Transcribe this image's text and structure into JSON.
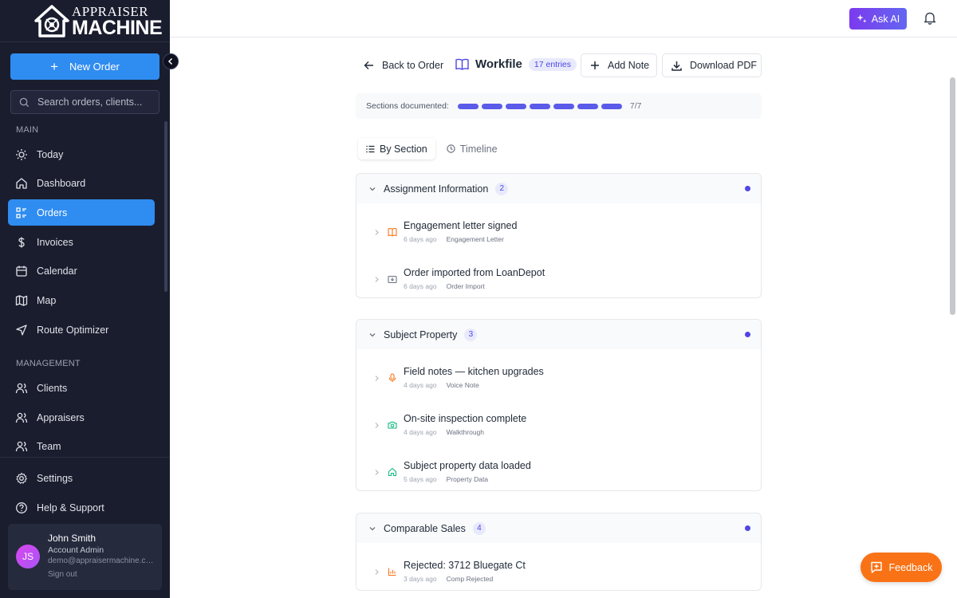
{
  "brand": {
    "line1": "APPRAISER",
    "line2": "MACHINE"
  },
  "sidebar": {
    "new_order": "New Order",
    "search_placeholder": "Search orders, clients...",
    "main_label": "MAIN",
    "main_items": [
      {
        "label": "Today",
        "icon": "sun-icon"
      },
      {
        "label": "Dashboard",
        "icon": "home-icon"
      },
      {
        "label": "Orders",
        "icon": "list-icon",
        "active": true
      },
      {
        "label": "Invoices",
        "icon": "dollar-icon"
      },
      {
        "label": "Calendar",
        "icon": "calendar-icon"
      },
      {
        "label": "Map",
        "icon": "map-icon"
      },
      {
        "label": "Route Optimizer",
        "icon": "navigation-icon"
      }
    ],
    "management_label": "MANAGEMENT",
    "management_items": [
      {
        "label": "Clients",
        "icon": "users-icon"
      },
      {
        "label": "Appraisers",
        "icon": "users-icon"
      },
      {
        "label": "Team",
        "icon": "users-icon"
      }
    ],
    "bottom_items": [
      {
        "label": "Settings",
        "icon": "gear-icon"
      },
      {
        "label": "Help & Support",
        "icon": "help-icon"
      }
    ],
    "user": {
      "initials": "JS",
      "name": "John Smith",
      "role": "Account Admin",
      "email": "demo@appraisermachine.com",
      "sign_out": "Sign out"
    }
  },
  "topbar": {
    "ask_ai": "Ask AI"
  },
  "workfile": {
    "back": "Back to Order",
    "title": "Workfile",
    "entries_badge": "17 entries",
    "add_note": "Add Note",
    "download_pdf": "Download PDF",
    "progress_label": "Sections documented:",
    "progress_value": "7/7",
    "progress_done": 7,
    "progress_total": 7,
    "tabs": [
      "By Section",
      "Timeline"
    ],
    "active_tab": 0
  },
  "sections": [
    {
      "title": "Assignment Information",
      "count": "2",
      "entries": [
        {
          "title": "Engagement letter signed",
          "age": "6 days ago",
          "source": "Engagement Letter",
          "icon": "book-icon",
          "color": "#f97316"
        },
        {
          "title": "Order imported from LoanDepot",
          "age": "6 days ago",
          "source": "Order Import",
          "icon": "download-icon",
          "color": "#6b7280"
        }
      ]
    },
    {
      "title": "Subject Property",
      "count": "3",
      "entries": [
        {
          "title": "Field notes — kitchen upgrades",
          "age": "4 days ago",
          "source": "Voice Note",
          "icon": "microphone-icon",
          "color": "#f97316"
        },
        {
          "title": "On-site inspection complete",
          "age": "4 days ago",
          "source": "Walkthrough",
          "icon": "camera-icon",
          "color": "#10b981"
        },
        {
          "title": "Subject property data loaded",
          "age": "5 days ago",
          "source": "Property Data",
          "icon": "home-icon",
          "color": "#10b981"
        }
      ]
    },
    {
      "title": "Comparable Sales",
      "count": "4",
      "entries": [
        {
          "title": "Rejected: 3712 Bluegate Ct",
          "age": "3 days ago",
          "source": "Comp Rejected",
          "icon": "bar-chart-icon",
          "color": "#f97316"
        }
      ]
    }
  ],
  "feedback": "Feedback"
}
